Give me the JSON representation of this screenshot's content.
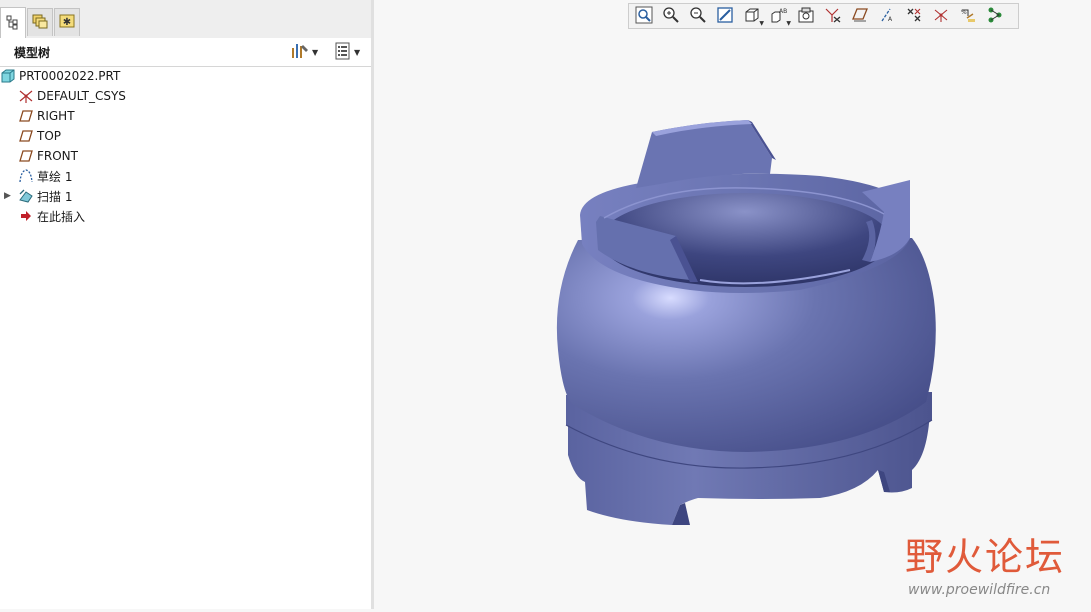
{
  "panel": {
    "tabs": [
      {
        "icon": "model-tree-icon",
        "active": true
      },
      {
        "icon": "layers-icon",
        "active": false
      },
      {
        "icon": "favorites-star-icon",
        "active": false
      }
    ],
    "tree_title": "模型树",
    "header_buttons": [
      "tree-settings-icon",
      "tree-filter-icon"
    ]
  },
  "tree": {
    "root": "PRT0002022.PRT",
    "items": [
      {
        "label": "DEFAULT_CSYS",
        "icon": "csys-icon"
      },
      {
        "label": "RIGHT",
        "icon": "datum-plane-icon"
      },
      {
        "label": "TOP",
        "icon": "datum-plane-icon"
      },
      {
        "label": "FRONT",
        "icon": "datum-plane-icon"
      },
      {
        "label": "草绘 1",
        "icon": "sketch-icon"
      },
      {
        "label": "扫描 1",
        "icon": "sweep-icon",
        "expandable": true
      },
      {
        "label": "在此插入",
        "icon": "insert-here-arrow-icon"
      }
    ]
  },
  "toolbar": {
    "buttons": [
      "refit-icon",
      "zoom-in-icon",
      "zoom-out-icon",
      "repaint-icon",
      "display-style-icon",
      "saved-orientations-icon",
      "view-manager-icon",
      "datum-display-filter-icon",
      "plane-display-icon",
      "axis-display-icon",
      "point-display-icon",
      "csys-display-icon",
      "annotation-display-icon",
      "spin-center-icon"
    ]
  },
  "model": {
    "name": "sweep-ring-part",
    "color": "#6a74b0"
  },
  "watermark": {
    "text": "野火论坛",
    "url": "www.proewildfire.cn"
  },
  "colors": {
    "model_base": "#6a74b0",
    "model_dark": "#4a5290",
    "model_light": "#a8b0e0",
    "insert_arrow": "#c0202a",
    "watermark": "#e05a3a"
  }
}
